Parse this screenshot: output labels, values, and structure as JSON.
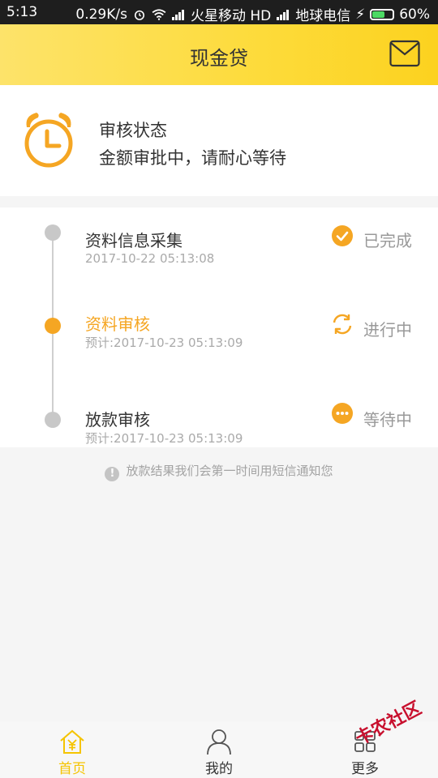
{
  "status_bar": {
    "time": "5:13",
    "speed": "0.29K/s",
    "carrier1": "火星移动 HD",
    "carrier2": "地球电信",
    "battery": "60%",
    "battery_level": 0.6
  },
  "header": {
    "title": "现金贷",
    "mail_icon": "mail-icon"
  },
  "status_card": {
    "icon": "alarm-clock-icon",
    "title": "审核状态",
    "description": "金额审批中，请耐心等待"
  },
  "timeline": {
    "steps": [
      {
        "name": "资料信息采集",
        "time": "2017-10-22 05:13:08",
        "status": "已完成",
        "state": "done",
        "icon": "check-circle-icon"
      },
      {
        "name": "资料审核",
        "time": "预计:2017-10-23 05:13:09",
        "status": "进行中",
        "state": "active",
        "icon": "refresh-icon"
      },
      {
        "name": "放款审核",
        "time": "预计:2017-10-23 05:13:09",
        "status": "等待中",
        "state": "waiting",
        "icon": "more-circle-icon"
      }
    ]
  },
  "notice": {
    "icon": "info-icon",
    "text": "放款结果我们会第一时间用短信通知您"
  },
  "bottom_nav": {
    "items": [
      {
        "label": "首页",
        "icon": "home-icon",
        "active": true
      },
      {
        "label": "我的",
        "icon": "user-icon",
        "active": false
      },
      {
        "label": "更多",
        "icon": "more-icon",
        "active": false
      }
    ]
  },
  "watermark": "卡农社区",
  "colors": {
    "accent": "#f5a623",
    "header_yellow": "#fddb3a",
    "nav_active": "#f5c400"
  }
}
